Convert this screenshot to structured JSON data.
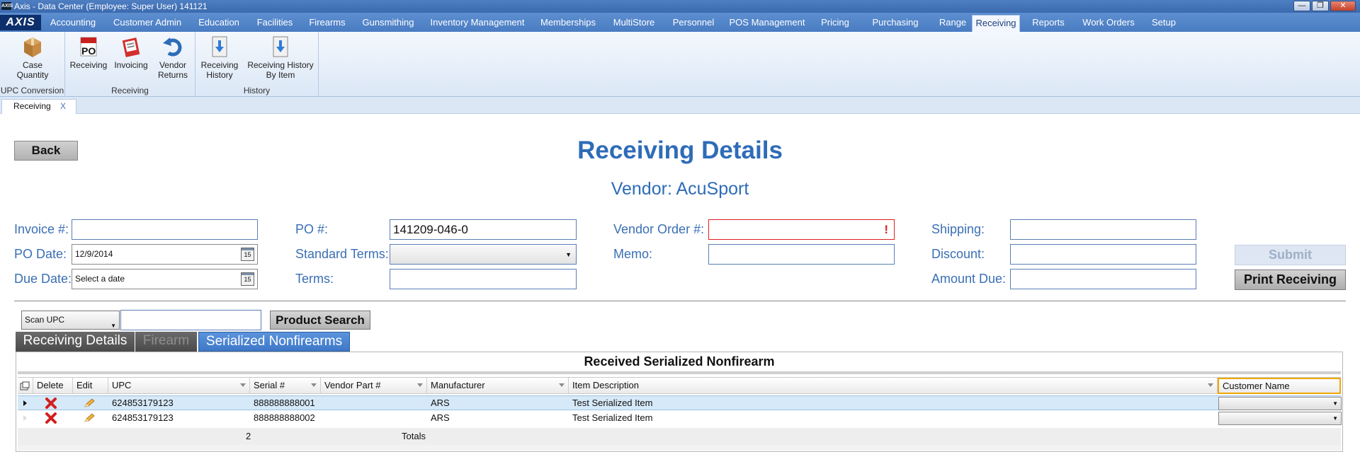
{
  "window": {
    "app_icon_text": "AXIS",
    "title": "Axis - Data Center  (Employee: Super User) 141121",
    "minimize": "—",
    "maximize": "❐",
    "close": "✕"
  },
  "menu": {
    "logo": "AXIS",
    "tabs": [
      "Accounting",
      "Customer Admin",
      "Education",
      "Facilities",
      "Firearms",
      "Gunsmithing",
      "Inventory Management",
      "Memberships",
      "MultiStore",
      "Personnel",
      "POS Management",
      "Pricing",
      "Purchasing",
      "Range",
      "Receiving",
      "Reports",
      "Work Orders",
      "Setup"
    ],
    "active": "Receiving"
  },
  "ribbon": {
    "groups": [
      {
        "label": "UPC Conversion",
        "buttons": [
          {
            "label": "Case Quantity",
            "icon": "box-icon"
          }
        ]
      },
      {
        "label": "Receiving",
        "buttons": [
          {
            "label": "Receiving",
            "icon": "po-icon"
          },
          {
            "label": "Invoicing",
            "icon": "invoice-icon"
          },
          {
            "label": "Vendor Returns",
            "icon": "return-arrow-icon"
          }
        ]
      },
      {
        "label": "History",
        "buttons": [
          {
            "label": "Receiving History",
            "icon": "download-doc-icon"
          },
          {
            "label": "Receiving History By Item",
            "icon": "download-doc-icon"
          }
        ]
      }
    ]
  },
  "doc_tab": {
    "label": "Receiving",
    "close": "X"
  },
  "page": {
    "back_label": "Back",
    "title": "Receiving Details",
    "vendor": "Vendor: AcuSport"
  },
  "form": {
    "invoice_label": "Invoice #:",
    "invoice_value": "",
    "po_date_label": "PO Date:",
    "po_date_value": "12/9/2014",
    "due_date_label": "Due Date:",
    "due_date_placeholder": "Select a date",
    "calendar_glyph": "15",
    "po_label": "PO #:",
    "po_value": "141209-046-0",
    "standard_terms_label": "Standard Terms:",
    "standard_terms_value": "",
    "terms_label": "Terms:",
    "terms_value": "",
    "vendor_order_label": "Vendor Order #:",
    "vendor_order_value": "",
    "vendor_order_error": "!",
    "memo_label": "Memo:",
    "memo_value": "",
    "shipping_label": "Shipping:",
    "discount_label": "Discount:",
    "amount_due_label": "Amount Due:",
    "submit_label": "Submit",
    "print_label": "Print Receiving",
    "error_color": "#e02020",
    "accent_color": "#2e6cb8"
  },
  "scan": {
    "mode": "Scan UPC",
    "input_value": "",
    "search_label": "Product Search"
  },
  "subtabs": [
    "Receiving Details",
    "Firearm",
    "Serialized Nonfirearms"
  ],
  "grid": {
    "caption": "Received Serialized Nonfirearm",
    "columns": [
      "Delete",
      "Edit",
      "UPC",
      "Serial #",
      "Vendor Part #",
      "Manufacturer",
      "Item Description",
      "Customer Name"
    ],
    "rows": [
      {
        "upc": "624853179123",
        "serial": "888888888001",
        "vendor_part": "",
        "manufacturer": "ARS",
        "description": "Test Serialized Item",
        "customer": ""
      },
      {
        "upc": "624853179123",
        "serial": "888888888002",
        "vendor_part": "",
        "manufacturer": "ARS",
        "description": "Test Serialized Item",
        "customer": ""
      }
    ],
    "totals_count": "2",
    "totals_label": "Totals"
  }
}
